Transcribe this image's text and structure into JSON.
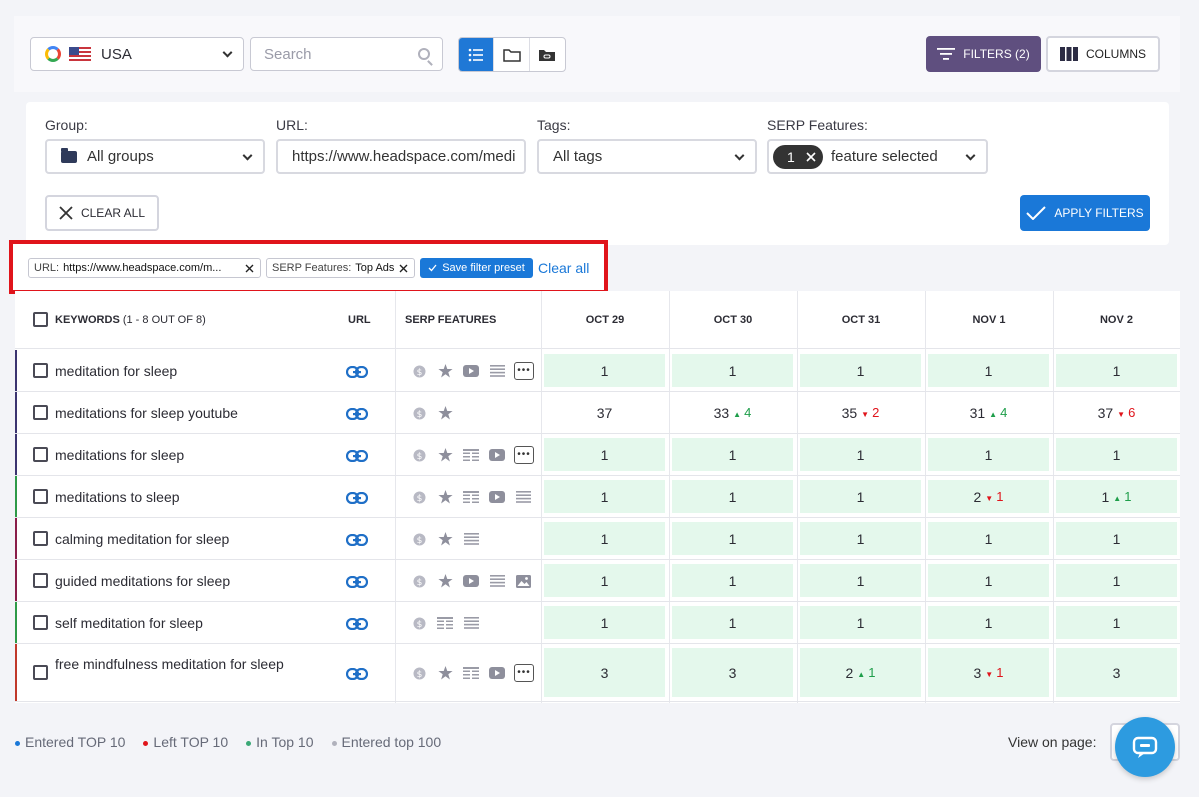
{
  "toolbar": {
    "country": "USA",
    "search_placeholder": "Search",
    "filters_label": "FILTERS (2)",
    "columns_label": "COLUMNS"
  },
  "filters": {
    "group_label": "Group:",
    "group_value": "All groups",
    "url_label": "URL:",
    "url_value": "https://www.headspace.com/medi",
    "tags_label": "Tags:",
    "tags_value": "All tags",
    "serp_label": "SERP Features:",
    "serp_count": "1",
    "serp_value": "feature selected",
    "clear_all": "CLEAR ALL",
    "apply": "APPLY FILTERS"
  },
  "active_filters": {
    "chips": [
      {
        "key": "URL:",
        "value": "https://www.headspace.com/m..."
      },
      {
        "key": "SERP Features:",
        "value": "Top Ads"
      }
    ],
    "save_preset": "Save filter preset",
    "clear_all": "Clear all"
  },
  "table": {
    "keywords_header": "KEYWORDS",
    "keywords_count": "(1 - 8 OUT OF 8)",
    "url_header": "URL",
    "serp_header": "SERP FEATURES",
    "dates": [
      "OCT 29",
      "OCT 30",
      "OCT 31",
      "NOV 1",
      "NOV 2"
    ],
    "rows": [
      {
        "keyword": "meditation for sleep",
        "bar": "#3b3470",
        "features": [
          "coin",
          "star",
          "video",
          "list",
          "more"
        ],
        "cells": [
          {
            "v": "1",
            "g": true
          },
          {
            "v": "1",
            "g": true
          },
          {
            "v": "1",
            "g": true
          },
          {
            "v": "1",
            "g": true
          },
          {
            "v": "1",
            "g": true
          }
        ]
      },
      {
        "keyword": "meditations for sleep youtube",
        "bar": "#3b3470",
        "features": [
          "coin",
          "star"
        ],
        "cells": [
          {
            "v": "37",
            "g": false
          },
          {
            "v": "33",
            "g": false,
            "d": "up",
            "c": "4"
          },
          {
            "v": "35",
            "g": false,
            "d": "down",
            "c": "2"
          },
          {
            "v": "31",
            "g": false,
            "d": "up",
            "c": "4"
          },
          {
            "v": "37",
            "g": false,
            "d": "down",
            "c": "6"
          }
        ]
      },
      {
        "keyword": "meditations for sleep",
        "bar": "#3b3470",
        "features": [
          "coin",
          "star",
          "table",
          "video",
          "more"
        ],
        "cells": [
          {
            "v": "1",
            "g": true
          },
          {
            "v": "1",
            "g": true
          },
          {
            "v": "1",
            "g": true
          },
          {
            "v": "1",
            "g": true
          },
          {
            "v": "1",
            "g": true
          }
        ]
      },
      {
        "keyword": "meditations to sleep",
        "bar": "#2e9a48",
        "features": [
          "coin",
          "star",
          "table",
          "video",
          "list"
        ],
        "cells": [
          {
            "v": "1",
            "g": true
          },
          {
            "v": "1",
            "g": true
          },
          {
            "v": "1",
            "g": true
          },
          {
            "v": "2",
            "g": true,
            "d": "down",
            "c": "1"
          },
          {
            "v": "1",
            "g": true,
            "d": "up",
            "c": "1"
          }
        ]
      },
      {
        "keyword": "calming meditation for sleep",
        "bar": "#8a1e4a",
        "features": [
          "coin",
          "star",
          "list"
        ],
        "cells": [
          {
            "v": "1",
            "g": true
          },
          {
            "v": "1",
            "g": true
          },
          {
            "v": "1",
            "g": true
          },
          {
            "v": "1",
            "g": true
          },
          {
            "v": "1",
            "g": true
          }
        ]
      },
      {
        "keyword": "guided meditations for sleep",
        "bar": "#8a1e4a",
        "features": [
          "coin",
          "star",
          "video",
          "list",
          "image"
        ],
        "cells": [
          {
            "v": "1",
            "g": true
          },
          {
            "v": "1",
            "g": true
          },
          {
            "v": "1",
            "g": true
          },
          {
            "v": "1",
            "g": true
          },
          {
            "v": "1",
            "g": true
          }
        ]
      },
      {
        "keyword": "self meditation for sleep",
        "bar": "#2e9a48",
        "features": [
          "coin",
          "table",
          "list"
        ],
        "cells": [
          {
            "v": "1",
            "g": true
          },
          {
            "v": "1",
            "g": true
          },
          {
            "v": "1",
            "g": true
          },
          {
            "v": "1",
            "g": true
          },
          {
            "v": "1",
            "g": true
          }
        ]
      },
      {
        "keyword": "free mindfulness meditation for sleep",
        "bar": "#c0392b",
        "features": [
          "coin",
          "star",
          "table",
          "video",
          "more"
        ],
        "cells": [
          {
            "v": "3",
            "g": true
          },
          {
            "v": "3",
            "g": true
          },
          {
            "v": "2",
            "g": true,
            "d": "up",
            "c": "1"
          },
          {
            "v": "3",
            "g": true,
            "d": "down",
            "c": "1"
          },
          {
            "v": "3",
            "g": true
          }
        ]
      }
    ]
  },
  "legend": [
    {
      "label": "Entered TOP 10",
      "color": "#1a78d8"
    },
    {
      "label": "Left TOP 10",
      "color": "#e0141b"
    },
    {
      "label": "In Top 10",
      "color": "#3aa876"
    },
    {
      "label": "Entered top 100",
      "color": "#b0b1bc"
    }
  ],
  "footer": {
    "view_on_page": "View on page:"
  },
  "colors": {
    "accent": "#1a78d8",
    "filters_btn": "#5f4f7f",
    "green_cell": "#e4f8ec",
    "highlight": "#e0141b"
  }
}
